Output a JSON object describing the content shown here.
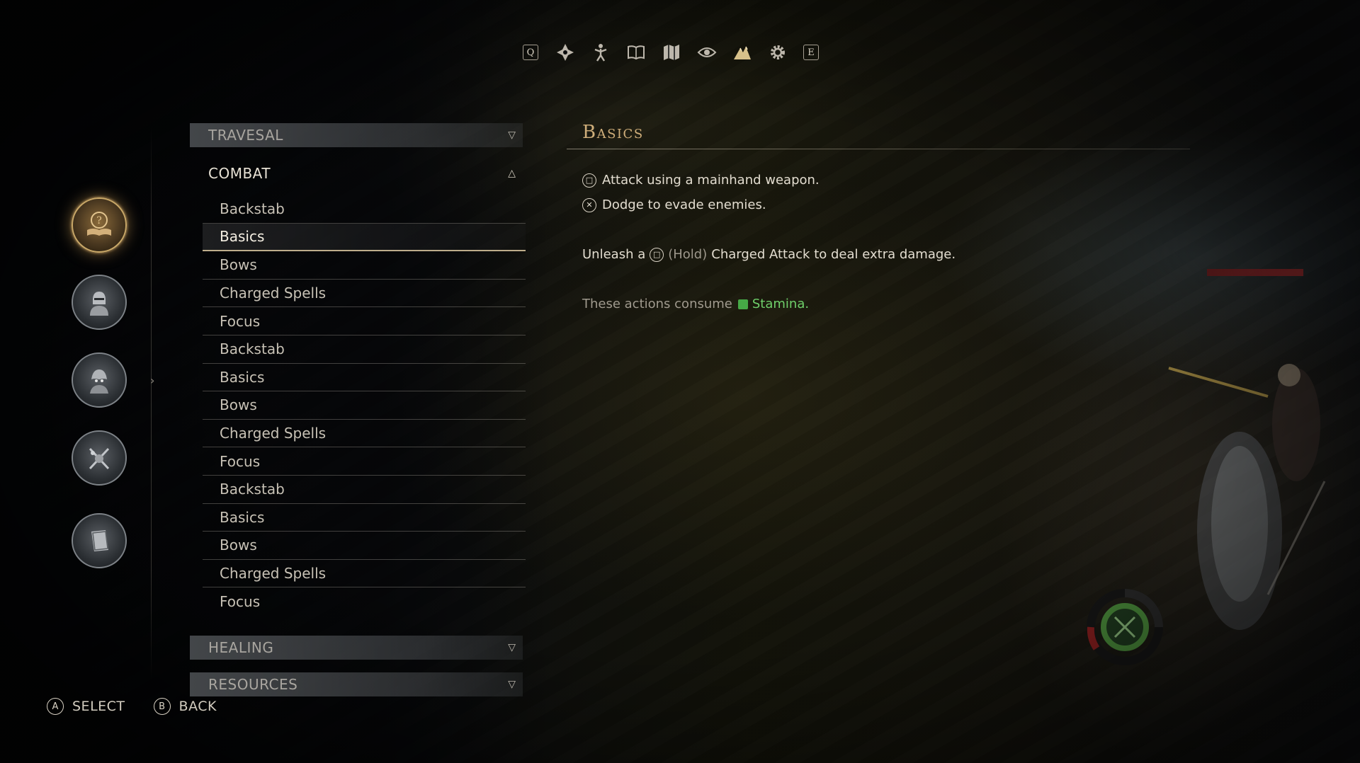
{
  "top_nav": {
    "left_key": "Q",
    "right_key": "E",
    "icons": [
      "skills-icon",
      "character-icon",
      "journal-icon",
      "map-icon",
      "vision-icon",
      "tutorial-icon",
      "settings-icon"
    ],
    "active_icon": "tutorial-icon"
  },
  "categories": [
    {
      "name": "tutorials-category",
      "icon": "book-question-icon",
      "active": true
    },
    {
      "name": "knight-category",
      "icon": "knight-icon",
      "active": false
    },
    {
      "name": "creatures-category",
      "icon": "creature-icon",
      "active": false
    },
    {
      "name": "items-category",
      "icon": "weapons-icon",
      "active": false
    },
    {
      "name": "lore-category",
      "icon": "tome-icon",
      "active": false
    }
  ],
  "sections": {
    "traversal": "TRAVESAL",
    "combat": "COMBAT",
    "healing": "HEALING",
    "resources": "RESOURCES"
  },
  "combat_items": [
    "Backstab",
    "Basics",
    "Bows",
    "Charged Spells",
    "Focus",
    "Backstab",
    "Basics",
    "Bows",
    "Charged Spells",
    "Focus",
    "Backstab",
    "Basics",
    "Bows",
    "Charged Spells",
    "Focus"
  ],
  "selected_index": 1,
  "detail": {
    "title": "Basics",
    "line1": "Attack using a mainhand weapon.",
    "line2": "Dodge to evade enemies.",
    "line3_prefix": "Unleash a",
    "line3_hold": "(Hold)",
    "line3_suffix": "Charged Attack to deal extra damage.",
    "line4_prefix": "These actions consume",
    "line4_stamina": "Stamina."
  },
  "footer": {
    "select_button": "A",
    "select_label": "SELECT",
    "back_button": "B",
    "back_label": "BACK"
  },
  "colors": {
    "accent_gold": "#cfae7a",
    "stamina_green": "#6fcf6a"
  }
}
